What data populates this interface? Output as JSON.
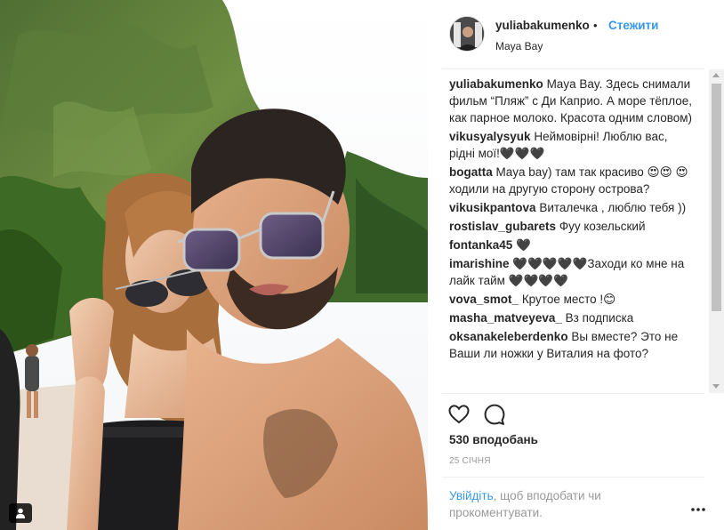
{
  "post": {
    "username": "yuliabakumenko",
    "separator": "•",
    "follow_label": "Стежити",
    "location": "Maya Bay"
  },
  "comments": [
    {
      "user": "yuliabakumenko",
      "text": "Maya Bay. Здесь снимали фильм “Пляж” с Ди Каприо. А море тёплое, как парное молоко. Красота одним словом)"
    },
    {
      "user": "vikusyalysyuk",
      "text": "Неймовірні! Люблю вас, рідні мої!🖤🖤🖤"
    },
    {
      "user": "bogatta",
      "text": "Maya bay) там так красиво 😍😍 😍 ходили на другую сторону острова?"
    },
    {
      "user": "vikusikpantova",
      "text": "Виталечка , люблю тебя ))"
    },
    {
      "user": "rostislav_gubarets",
      "text": "Фуу козельский"
    },
    {
      "user": "fontanka45",
      "text": "🖤"
    },
    {
      "user": "imarishine",
      "text": "🖤🖤🖤🖤🖤Заходи ко мне на лайк тайм 🖤🖤🖤🖤"
    },
    {
      "user": "vova_smot_",
      "text": "Крутое место !😊"
    },
    {
      "user": "masha_matveyeva_",
      "text": "Вз подписка"
    },
    {
      "user": "oksanakeleberdenko",
      "text": "Вы вместе? Это не Ваши ли ножки у Виталия на фото?"
    }
  ],
  "likes_label": "530 вподобань",
  "date_label": "25 СІЧНЯ",
  "login_prompt": {
    "link": "Увійдіть",
    "text": ", щоб вподобати чи прокоментувати."
  },
  "icons": {
    "like": "heart-icon",
    "comment": "comment-bubble-icon",
    "more": "more-options-icon",
    "tag": "user-tag-icon"
  },
  "colors": {
    "accent": "#3897f0",
    "muted": "#999999",
    "text": "#262626"
  }
}
